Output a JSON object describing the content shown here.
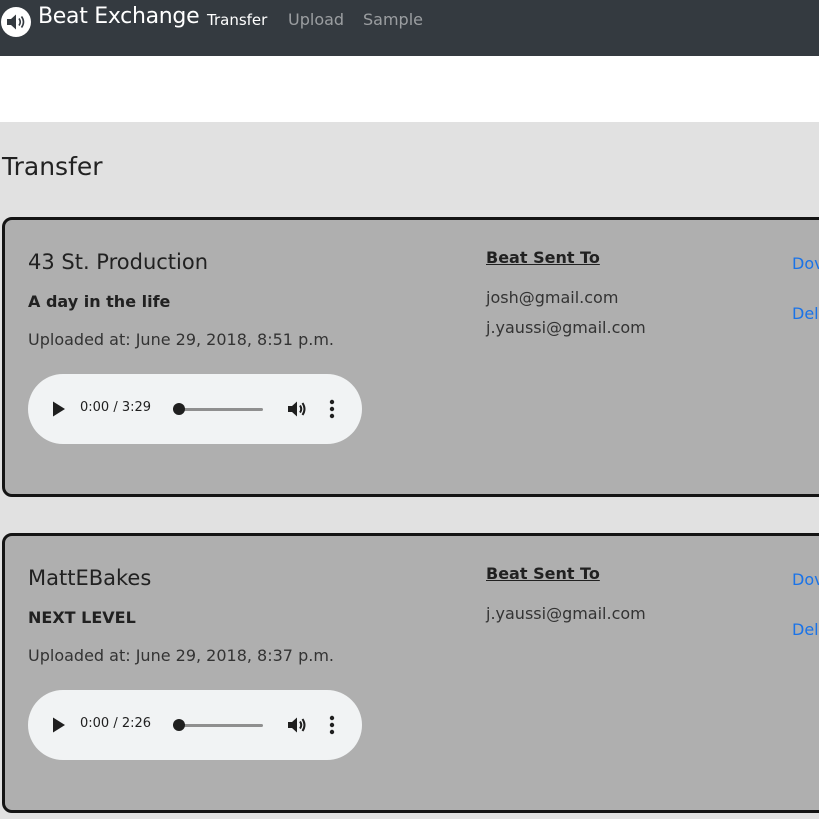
{
  "navbar": {
    "brand": "Beat Exchange",
    "brand_icon": "speaker-icon",
    "links": [
      {
        "label": "Transfer",
        "active": true
      },
      {
        "label": "Upload",
        "active": false
      },
      {
        "label": "Sample",
        "active": false
      }
    ]
  },
  "page": {
    "title": "Transfer"
  },
  "transfers": [
    {
      "producer": "43 St. Production",
      "title": "A day in the life",
      "uploaded": "Uploaded at: June 29, 2018, 8:51 p.m.",
      "player": {
        "time": "0:00 / 3:29",
        "progress": 0
      },
      "sent_to_heading": "Beat Sent To",
      "recipients": [
        "josh@gmail.com",
        "j.yaussi@gmail.com"
      ],
      "actions": {
        "download": "Dov",
        "delete": "Del"
      }
    },
    {
      "producer": "MattEBakes",
      "title": "NEXT LEVEL",
      "uploaded": "Uploaded at: June 29, 2018, 8:37 p.m.",
      "player": {
        "time": "0:00 / 2:26",
        "progress": 0
      },
      "sent_to_heading": "Beat Sent To",
      "recipients": [
        "j.yaussi@gmail.com"
      ],
      "actions": {
        "download": "Dov",
        "delete": "Del"
      }
    }
  ],
  "colors": {
    "navbar": "#343a40",
    "content_bg": "#e1e1e1",
    "card_bg": "#afafaf",
    "link": "#1a73e8"
  }
}
